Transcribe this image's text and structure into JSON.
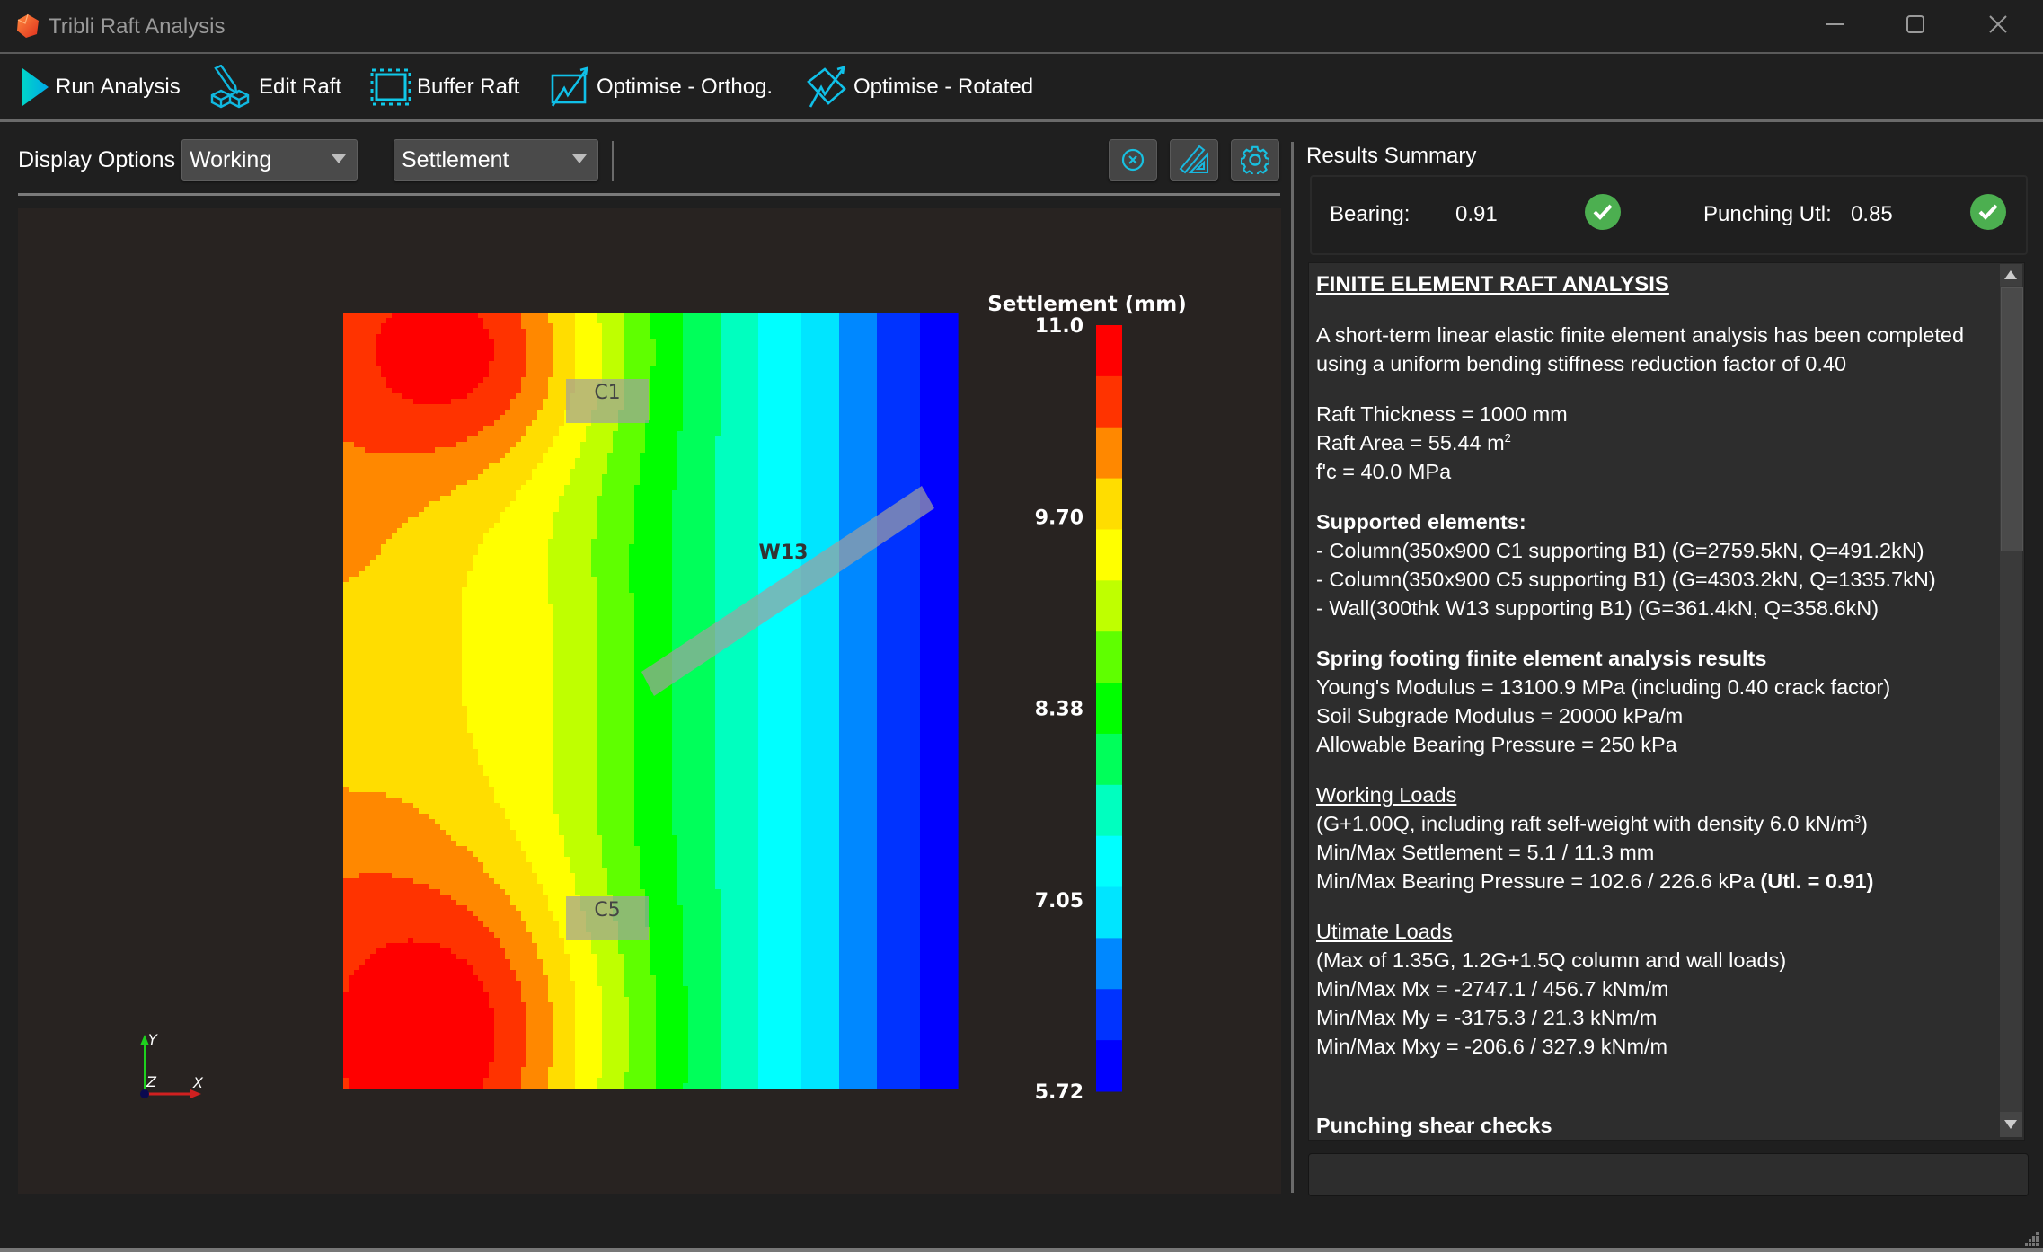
{
  "window": {
    "title": "Tribli Raft Analysis",
    "controls": {
      "minimize": "—",
      "maximize": "☐",
      "close": "✕"
    }
  },
  "toolbar": {
    "items": [
      {
        "label": "Run Analysis",
        "icon": "play-icon"
      },
      {
        "label": "Edit Raft",
        "icon": "edit-raft-icon"
      },
      {
        "label": "Buffer Raft",
        "icon": "buffer-raft-icon"
      },
      {
        "label": "Optimise - Orthog.",
        "icon": "optimise-orthog-icon"
      },
      {
        "label": "Optimise - Rotated",
        "icon": "optimise-rotated-icon"
      }
    ],
    "accent": "#00c8e0"
  },
  "display_options": {
    "label": "Display Options",
    "load_case": "Working",
    "result_type": "Settlement",
    "icon_buttons": [
      "clear-icon",
      "measure-icon",
      "settings-icon"
    ]
  },
  "plot": {
    "colorbar": {
      "title": "Settlement (mm)",
      "tick_labels": [
        "11.0",
        "9.70",
        "8.38",
        "7.05",
        "5.72"
      ],
      "min": 5.72,
      "max": 11.0,
      "colors_top_to_bottom": [
        "#ff0000",
        "#ff3300",
        "#ff8800",
        "#ffdd00",
        "#ffff00",
        "#bfff00",
        "#5fff00",
        "#00ff00",
        "#00ff5a",
        "#00ffbf",
        "#00ffff",
        "#00e5ff",
        "#0088ff",
        "#0033ff",
        "#0000ff"
      ]
    },
    "elements": [
      {
        "label": "C1",
        "type": "column"
      },
      {
        "label": "C5",
        "type": "column"
      },
      {
        "label": "W13",
        "type": "wall"
      }
    ],
    "axes": {
      "x": "X",
      "y": "Y",
      "z": "Z"
    }
  },
  "results": {
    "title": "Results Summary",
    "bearing_label": "Bearing:",
    "bearing_value": "0.91",
    "bearing_status": "pass",
    "punching_label": "Punching Utl:",
    "punching_value": "0.85",
    "punching_status": "pass",
    "status_color": "#4caf50"
  },
  "report": {
    "heading": "FINITE ELEMENT RAFT ANALYSIS",
    "intro": "A short-term linear elastic finite element analysis has been completed using a uniform bending stiffness reduction factor of 0.40",
    "raft_thickness": "Raft Thickness = 1000 mm",
    "raft_area": "Raft Area = 55.44 m",
    "raft_area_sup": "2",
    "fc": "f'c = 40.0 MPa",
    "supported_heading": "Supported elements:",
    "supported": [
      "- Column(350x900 C1 supporting B1) (G=2759.5kN, Q=491.2kN)",
      "- Column(350x900 C5 supporting B1) (G=4303.2kN, Q=1335.7kN)",
      "- Wall(300thk W13 supporting B1) (G=361.4kN, Q=358.6kN)"
    ],
    "spring_heading": "Spring footing finite element analysis results",
    "spring": [
      "Young's Modulus = 13100.9 MPa (including 0.40 crack factor)",
      "Soil Subgrade Modulus = 20000 kPa/m",
      "Allowable Bearing Pressure = 250 kPa"
    ],
    "working_heading": "Working Loads",
    "working_desc": "(G+1.00Q, including raft self-weight with density 6.0 kN/m",
    "working_desc_sup": "3",
    "working_desc_end": ")",
    "working_settlement": "Min/Max Settlement = 5.1 / 11.3 mm",
    "working_bearing": "Min/Max Bearing Pressure = 102.6 / 226.6 kPa ",
    "working_bearing_utl": " (Utl. = 0.91)",
    "ultimate_heading": "Utimate Loads",
    "ultimate": [
      "(Max of 1.35G, 1.2G+1.5Q column and wall loads)",
      "Min/Max Mx = -2747.1 / 456.7 kNm/m",
      "Min/Max My = -3175.3 / 21.3 kNm/m",
      "Min/Max Mxy = -206.6 / 327.9 kNm/m"
    ],
    "punching_heading": "Punching shear checks"
  },
  "bottom_input": {
    "value": ""
  }
}
